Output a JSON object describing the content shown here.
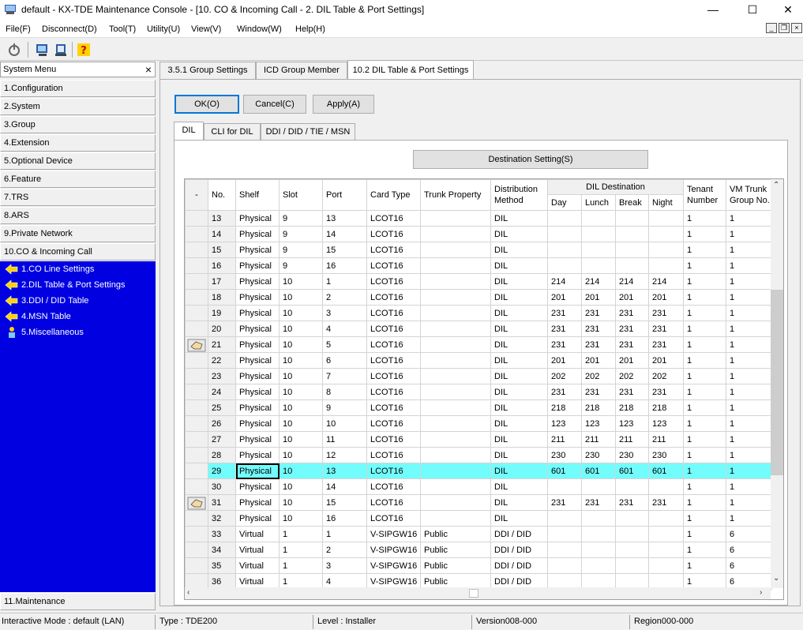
{
  "window": {
    "title": "default - KX-TDE Maintenance Console - [10. CO & Incoming Call - 2. DIL Table & Port Settings]",
    "minimize": "—",
    "maximize": "☐",
    "close": "✕"
  },
  "menu": [
    "File(F)",
    "Disconnect(D)",
    "Tool(T)",
    "Utility(U)",
    "View(V)",
    "Window(W)",
    "Help(H)"
  ],
  "sidebar": {
    "title": "System Menu",
    "close": "×",
    "items": [
      "1.Configuration",
      "2.System",
      "3.Group",
      "4.Extension",
      "5.Optional Device",
      "6.Feature",
      "7.TRS",
      "8.ARS",
      "9.Private Network",
      "10.CO & Incoming Call"
    ],
    "sub_items": [
      "1.CO Line Settings",
      "2.DIL Table & Port Settings",
      "3.DDI / DID Table",
      "4.MSN Table",
      "5.Miscellaneous"
    ],
    "bottom_item": "11.Maintenance"
  },
  "tabs": [
    "3.5.1 Group Settings",
    "ICD Group Member",
    "10.2 DIL Table & Port Settings"
  ],
  "buttons": {
    "ok": "OK(O)",
    "cancel": "Cancel(C)",
    "apply": "Apply(A)",
    "destination": "Destination Setting(S)"
  },
  "inner_tabs": [
    "DIL",
    "CLI for DIL",
    "DDI / DID / TIE / MSN"
  ],
  "grid": {
    "corner": "-",
    "headers": {
      "no": "No.",
      "shelf": "Shelf",
      "slot": "Slot",
      "port": "Port",
      "card_type": "Card Type",
      "trunk_property": "Trunk Property",
      "distribution": "Distribution Method",
      "dil_destination": "DIL Destination",
      "day": "Day",
      "lunch": "Lunch",
      "break": "Break",
      "night": "Night",
      "tenant": "Tenant Number",
      "vm_trunk": "VM Trunk Group No."
    },
    "rows": [
      [
        "13",
        "Physical",
        "9",
        "13",
        "LCOT16",
        "",
        "DIL",
        "",
        "",
        "",
        "",
        "1",
        "1"
      ],
      [
        "14",
        "Physical",
        "9",
        "14",
        "LCOT16",
        "",
        "DIL",
        "",
        "",
        "",
        "",
        "1",
        "1"
      ],
      [
        "15",
        "Physical",
        "9",
        "15",
        "LCOT16",
        "",
        "DIL",
        "",
        "",
        "",
        "",
        "1",
        "1"
      ],
      [
        "16",
        "Physical",
        "9",
        "16",
        "LCOT16",
        "",
        "DIL",
        "",
        "",
        "",
        "",
        "1",
        "1"
      ],
      [
        "17",
        "Physical",
        "10",
        "1",
        "LCOT16",
        "",
        "DIL",
        "214",
        "214",
        "214",
        "214",
        "1",
        "1"
      ],
      [
        "18",
        "Physical",
        "10",
        "2",
        "LCOT16",
        "",
        "DIL",
        "201",
        "201",
        "201",
        "201",
        "1",
        "1"
      ],
      [
        "19",
        "Physical",
        "10",
        "3",
        "LCOT16",
        "",
        "DIL",
        "231",
        "231",
        "231",
        "231",
        "1",
        "1"
      ],
      [
        "20",
        "Physical",
        "10",
        "4",
        "LCOT16",
        "",
        "DIL",
        "231",
        "231",
        "231",
        "231",
        "1",
        "1"
      ],
      [
        "21",
        "Physical",
        "10",
        "5",
        "LCOT16",
        "",
        "DIL",
        "231",
        "231",
        "231",
        "231",
        "1",
        "1"
      ],
      [
        "22",
        "Physical",
        "10",
        "6",
        "LCOT16",
        "",
        "DIL",
        "201",
        "201",
        "201",
        "201",
        "1",
        "1"
      ],
      [
        "23",
        "Physical",
        "10",
        "7",
        "LCOT16",
        "",
        "DIL",
        "202",
        "202",
        "202",
        "202",
        "1",
        "1"
      ],
      [
        "24",
        "Physical",
        "10",
        "8",
        "LCOT16",
        "",
        "DIL",
        "231",
        "231",
        "231",
        "231",
        "1",
        "1"
      ],
      [
        "25",
        "Physical",
        "10",
        "9",
        "LCOT16",
        "",
        "DIL",
        "218",
        "218",
        "218",
        "218",
        "1",
        "1"
      ],
      [
        "26",
        "Physical",
        "10",
        "10",
        "LCOT16",
        "",
        "DIL",
        "123",
        "123",
        "123",
        "123",
        "1",
        "1"
      ],
      [
        "27",
        "Physical",
        "10",
        "11",
        "LCOT16",
        "",
        "DIL",
        "211",
        "211",
        "211",
        "211",
        "1",
        "1"
      ],
      [
        "28",
        "Physical",
        "10",
        "12",
        "LCOT16",
        "",
        "DIL",
        "230",
        "230",
        "230",
        "230",
        "1",
        "1"
      ],
      [
        "29",
        "Physical",
        "10",
        "13",
        "LCOT16",
        "",
        "DIL",
        "601",
        "601",
        "601",
        "601",
        "1",
        "1"
      ],
      [
        "30",
        "Physical",
        "10",
        "14",
        "LCOT16",
        "",
        "DIL",
        "",
        "",
        "",
        "",
        "1",
        "1"
      ],
      [
        "31",
        "Physical",
        "10",
        "15",
        "LCOT16",
        "",
        "DIL",
        "231",
        "231",
        "231",
        "231",
        "1",
        "1"
      ],
      [
        "32",
        "Physical",
        "10",
        "16",
        "LCOT16",
        "",
        "DIL",
        "",
        "",
        "",
        "",
        "1",
        "1"
      ],
      [
        "33",
        "Virtual",
        "1",
        "1",
        "V-SIPGW16",
        "Public",
        "DDI / DID",
        "",
        "",
        "",
        "",
        "1",
        "6"
      ],
      [
        "34",
        "Virtual",
        "1",
        "2",
        "V-SIPGW16",
        "Public",
        "DDI / DID",
        "",
        "",
        "",
        "",
        "1",
        "6"
      ],
      [
        "35",
        "Virtual",
        "1",
        "3",
        "V-SIPGW16",
        "Public",
        "DDI / DID",
        "",
        "",
        "",
        "",
        "1",
        "6"
      ],
      [
        "36",
        "Virtual",
        "1",
        "4",
        "V-SIPGW16",
        "Public",
        "DDI / DID",
        "",
        "",
        "",
        "",
        "1",
        "6"
      ]
    ],
    "highlighted_row": "29",
    "marked_rows": [
      "21",
      "31"
    ],
    "highlight_color": "#73fcfc"
  },
  "statusbar": {
    "mode": "Interactive Mode : default (LAN)",
    "type": "Type : TDE200",
    "level": "Level : Installer",
    "version": "Version008-000",
    "region": "Region000-000"
  },
  "colors": {
    "sidebar_blue": "#0000e1"
  }
}
